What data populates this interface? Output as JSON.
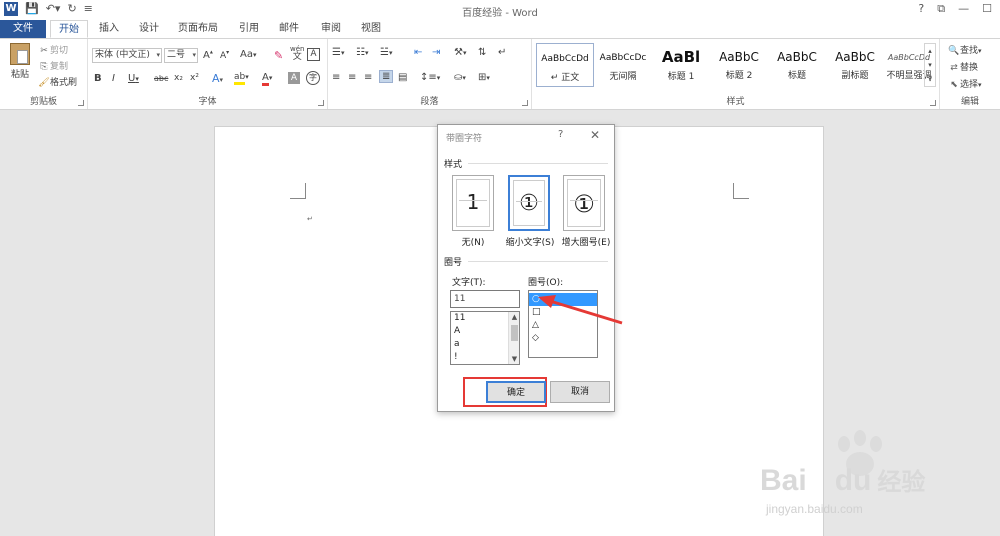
{
  "window": {
    "title": "百度经验 - Word",
    "controls": [
      "?",
      "⧉",
      "—",
      "☐"
    ]
  },
  "tabs": [
    "文件",
    "开始",
    "插入",
    "设计",
    "页面布局",
    "引用",
    "邮件",
    "审阅",
    "视图"
  ],
  "ribbon": {
    "clipboard": {
      "group_label": "剪贴板",
      "paste_label": "粘贴",
      "cut_label": "剪切",
      "copy_label": "复制",
      "format_painter_label": "格式刷"
    },
    "font": {
      "group_label": "字体",
      "font_name": "宋体 (中文正)",
      "font_size": "二号",
      "change_case_label": "Aa",
      "wen_top": "wén",
      "wen_bottom": "文",
      "boxed_char": "A",
      "bold": "B",
      "italic": "I",
      "underline": "U",
      "strikethrough": "abc",
      "subscript": "x₂",
      "superscript": "x²",
      "text_effects": "A",
      "highlight": "ab",
      "font_color": "A",
      "char_shading": "A",
      "enclose_char": "字"
    },
    "paragraph": {
      "group_label": "段落"
    },
    "styles": {
      "group_label": "样式",
      "items": [
        {
          "sample": "AaBbCcDd",
          "name": "↵ 正文"
        },
        {
          "sample": "AaBbCcDc",
          "name": "无间隔"
        },
        {
          "sample": "AaBl",
          "name": "标题 1"
        },
        {
          "sample": "AaBbC",
          "name": "标题 2"
        },
        {
          "sample": "AaBbC",
          "name": "标题"
        },
        {
          "sample": "AaBbC",
          "name": "副标题"
        },
        {
          "sample": "AaBbCcDd",
          "name": "不明显强调"
        }
      ]
    },
    "editing": {
      "group_label": "编辑",
      "find_label": "查找",
      "replace_label": "替换",
      "select_label": "选择"
    }
  },
  "document": {
    "paragraph_mark": "↵"
  },
  "dialog": {
    "title": "带圈字符",
    "help": "?",
    "close": "✕",
    "style_section": "样式",
    "style_options": [
      {
        "label": "无(N)",
        "preview": "1"
      },
      {
        "label": "缩小文字(S)",
        "preview": "①"
      },
      {
        "label": "增大圈号(E)",
        "preview": "①"
      }
    ],
    "enclosure_section": "圈号",
    "text_label": "文字(T):",
    "text_value": "11",
    "text_list": [
      "11",
      "A",
      "a",
      "!"
    ],
    "enclosure_label": "圈号(O):",
    "enclosure_list": [
      "○",
      "□",
      "△",
      "◇"
    ],
    "ok_label": "确定",
    "cancel_label": "取消"
  },
  "watermark": {
    "brand": "Bai",
    "brand2": "du",
    "brand_cn": "经验",
    "url": "jingyan.baidu.com"
  },
  "colors": {
    "accent": "#2b579a",
    "selection": "#3399ff",
    "annotation": "#e53935"
  }
}
